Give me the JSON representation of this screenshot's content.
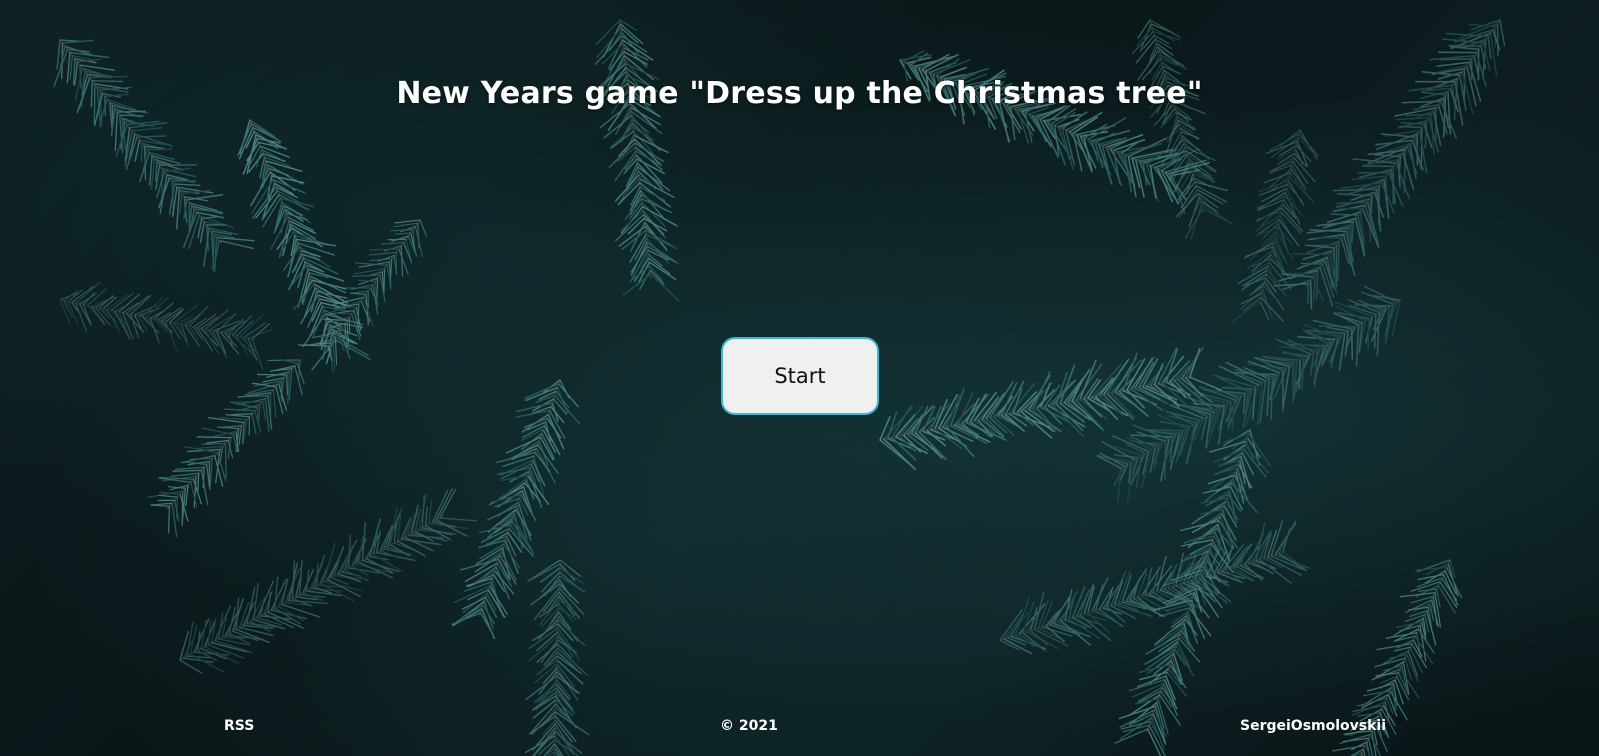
{
  "header": {
    "title": "New Years game \"Dress up the Christmas tree\""
  },
  "main": {
    "start_label": "Start"
  },
  "footer": {
    "rss_label": "RSS",
    "copyright": "© 2021",
    "author": "SergeiOsmolovskii"
  },
  "colors": {
    "background": "#0d1a1d",
    "needles": "#5fa8a4",
    "button_border": "#3fb6d3",
    "button_fill": "#f0f0f0",
    "text": "#ffffff"
  }
}
